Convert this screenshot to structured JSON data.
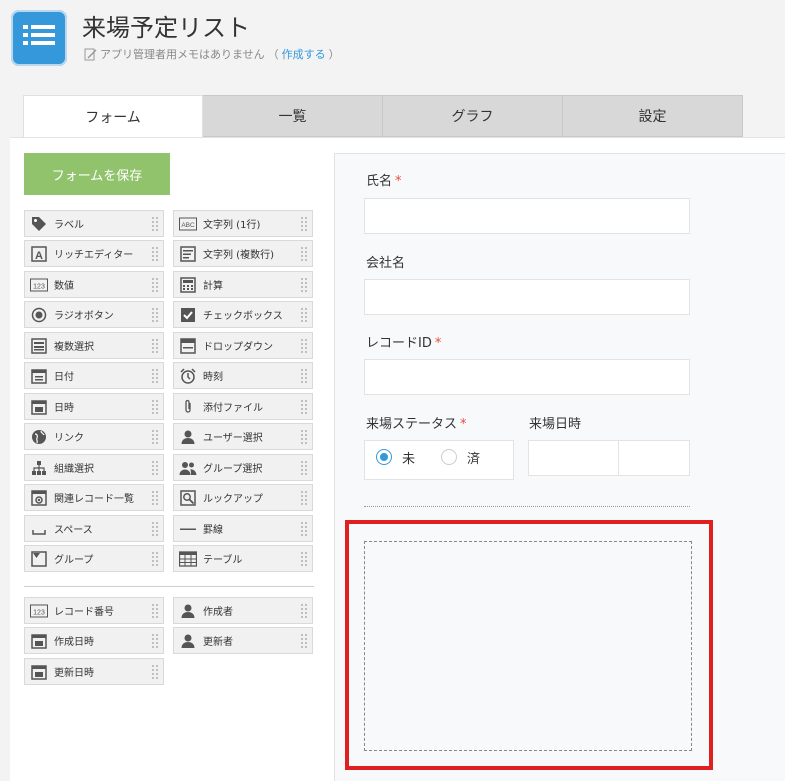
{
  "app": {
    "title": "来場予定リスト",
    "memo": "アプリ管理者用メモはありません",
    "memo_open": "（",
    "memo_create": "作成する",
    "memo_close": "）"
  },
  "tabs": [
    {
      "label": "フォーム",
      "active": true
    },
    {
      "label": "一覧",
      "active": false
    },
    {
      "label": "グラフ",
      "active": false
    },
    {
      "label": "設定",
      "active": false
    }
  ],
  "save_button": "フォームを保存",
  "palette": {
    "left": [
      "ラベル",
      "リッチエディター",
      "数値",
      "ラジオボタン",
      "複数選択",
      "日付",
      "日時",
      "リンク",
      "組織選択",
      "関連レコード一覧",
      "スペース",
      "グループ"
    ],
    "right": [
      "文字列 (1行)",
      "文字列 (複数行)",
      "計算",
      "チェックボックス",
      "ドロップダウン",
      "時刻",
      "添付ファイル",
      "ユーザー選択",
      "グループ選択",
      "ルックアップ",
      "罫線",
      "テーブル"
    ],
    "system_left": [
      "レコード番号",
      "作成日時",
      "更新日時"
    ],
    "system_right": [
      "作成者",
      "更新者"
    ]
  },
  "form": {
    "name_label": "氏名",
    "company_label": "会社名",
    "record_id_label": "レコードID",
    "status_label": "来場ステータス",
    "datetime_label": "来場日時",
    "required_mark": "*",
    "radio_options": [
      "未",
      "済"
    ],
    "radio_selected": "未"
  },
  "colors": {
    "accent": "#3498db",
    "save_button": "#91c36c",
    "required": "#e74c3c",
    "highlight": "#e02020"
  }
}
